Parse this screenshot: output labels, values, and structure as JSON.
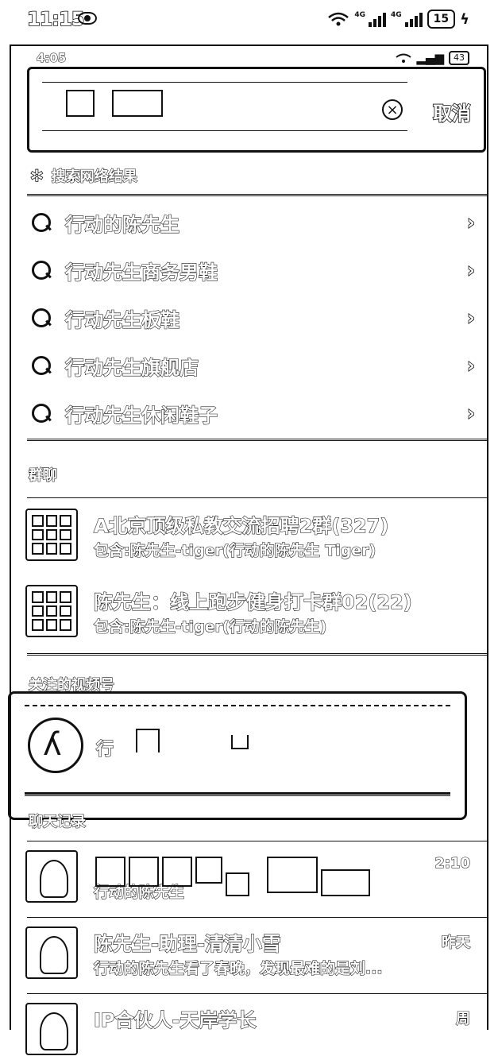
{
  "status_bar": {
    "time": "11:15",
    "network_1": "4G",
    "network_2": "4G",
    "battery": "15"
  },
  "inner_status_bar": {
    "time": "4:05",
    "battery": "43"
  },
  "search": {
    "cancel_label": "取消",
    "clear_icon": "clear-icon"
  },
  "web_results": {
    "header": "搜索网络结果",
    "items": [
      {
        "label": "行动的陈先生"
      },
      {
        "label": "行动先生商务男鞋"
      },
      {
        "label": "行动先生板鞋"
      },
      {
        "label": "行动先生旗舰店"
      },
      {
        "label": "行动先生休闲鞋子"
      }
    ]
  },
  "groups": {
    "header": "群聊",
    "items": [
      {
        "title": "A北京顶级私教交流招聘2群(327)",
        "subtitle": "包含:陈先生-tiger(行动的陈先生 Tiger)"
      },
      {
        "title": "陈先生：线上跑步健身打卡群02(22)",
        "subtitle": "包含:陈先生-tiger(行动的陈先生)"
      }
    ]
  },
  "followed_channels": {
    "header": "关注的视频号",
    "item_name_prefix": "行"
  },
  "chats": {
    "header": "聊天记录",
    "items": [
      {
        "name": "",
        "preview": "行动的陈先生",
        "time": "2:10"
      },
      {
        "name": "陈先生-助理-清清小雪",
        "preview": "行动的陈先生看了春晚，发现最难的是刘...",
        "time": "昨天"
      },
      {
        "name": "IP合伙人-天岸学长",
        "preview": "",
        "time": "周"
      }
    ]
  }
}
